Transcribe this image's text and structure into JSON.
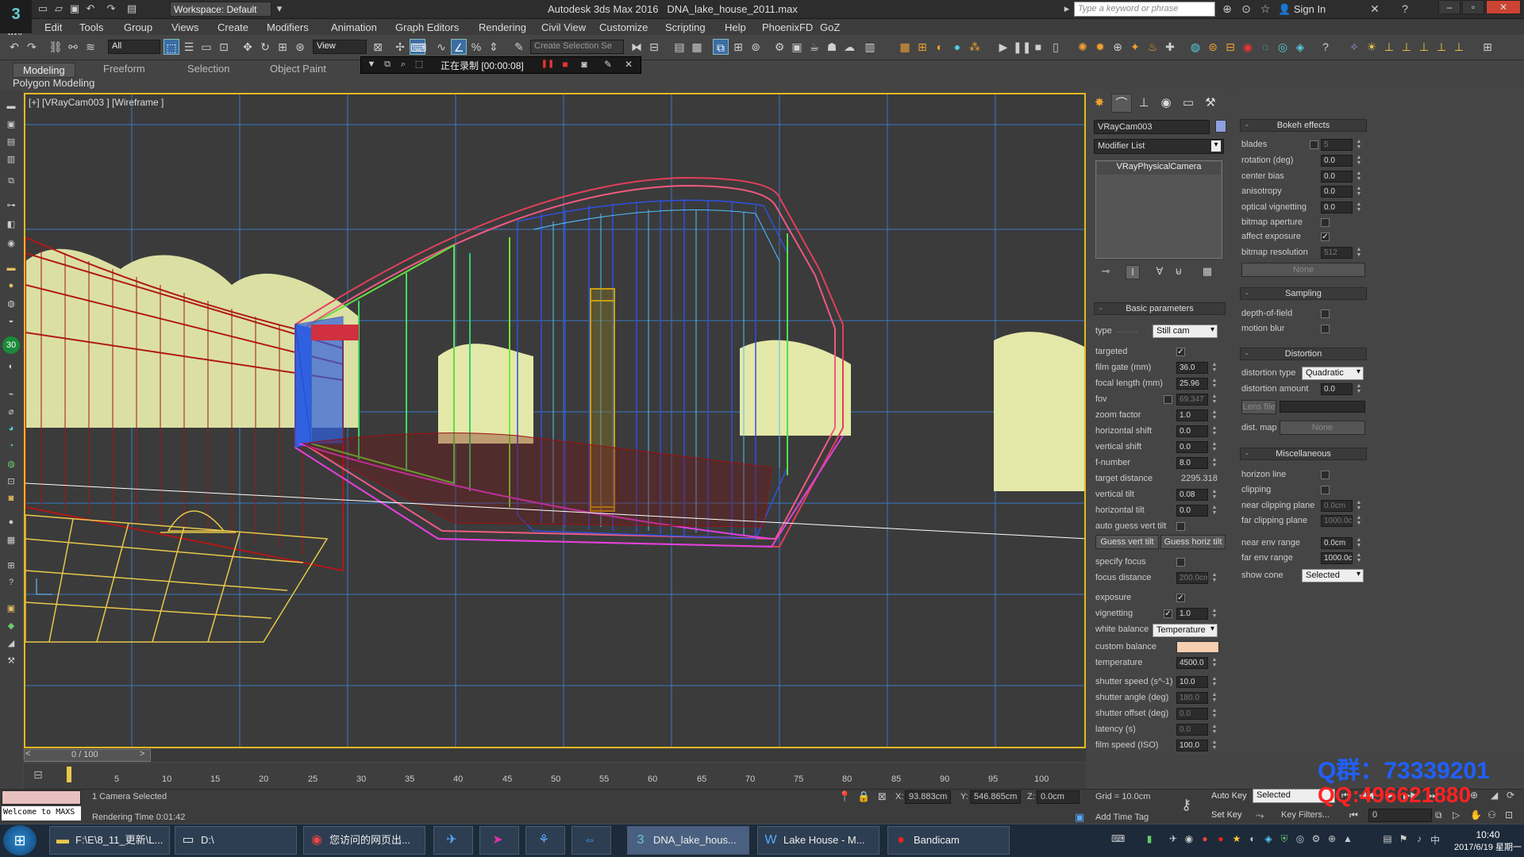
{
  "title": {
    "app": "Autodesk 3ds Max 2016",
    "file": "DNA_lake_house_2011.max",
    "workspace": "Workspace: Default",
    "search_placeholder": "Type a keyword or phrase",
    "signin": "Sign In",
    "logo": "MAX"
  },
  "menu": [
    "Edit",
    "Tools",
    "Group",
    "Views",
    "Create",
    "Modifiers",
    "Animation",
    "Graph Editors",
    "Rendering",
    "Civil View",
    "Customize",
    "Scripting",
    "Help",
    "PhoenixFD",
    "GoZ"
  ],
  "toolbar": {
    "filter": "All",
    "refcoord": "View",
    "selset_placeholder": "Create Selection Se"
  },
  "ribbon": {
    "tabs": [
      "Modeling",
      "Freeform",
      "Selection",
      "Object Paint"
    ],
    "active": "Modeling",
    "subtitle": "Polygon Modeling"
  },
  "recorder": {
    "text": "正在录制 [00:00:08]"
  },
  "viewport": {
    "label": "[+] [VRayCam003 ] [Wireframe ]"
  },
  "panel": {
    "object_name": "VRayCam003",
    "object_color": "#8fa0e0",
    "modifier_list": "Modifier List",
    "stack_item": "VRayPhysicalCamera"
  },
  "basic": {
    "header": "Basic parameters",
    "type_label": "type",
    "type_value": "Still cam",
    "targeted": "targeted",
    "film_gate": {
      "label": "film gate (mm)",
      "value": "36.0"
    },
    "focal_length": {
      "label": "focal length (mm)",
      "value": "25.96"
    },
    "fov": {
      "label": "fov",
      "value": "69.347"
    },
    "zoom_factor": {
      "label": "zoom factor",
      "value": "1.0"
    },
    "hshift": {
      "label": "horizontal shift",
      "value": "0.0"
    },
    "vshift": {
      "label": "vertical shift",
      "value": "0.0"
    },
    "fnumber": {
      "label": "f-number",
      "value": "8.0"
    },
    "target_distance": {
      "label": "target distance",
      "value": "2295.318"
    },
    "vtilt": {
      "label": "vertical tilt",
      "value": "0.08"
    },
    "htilt": {
      "label": "horizontal tilt",
      "value": "0.0"
    },
    "auto_guess": "auto guess vert tilt",
    "guess_vert": "Guess vert tilt",
    "guess_horiz": "Guess horiz tilt",
    "specify_focus": "specify focus",
    "focus_distance": {
      "label": "focus distance",
      "value": "200.0cm"
    },
    "exposure": "exposure",
    "vignetting": {
      "label": "vignetting",
      "value": "1.0"
    },
    "white_balance_label": "white balance",
    "white_balance_value": "Temperature",
    "custom_balance": "custom balance",
    "custom_balance_color": "#f5cfb0",
    "temperature": {
      "label": "temperature",
      "value": "4500.0"
    },
    "shutter_speed": {
      "label": "shutter speed (s^-1)",
      "value": "10.0"
    },
    "shutter_angle": {
      "label": "shutter angle (deg)",
      "value": "180.0"
    },
    "shutter_offset": {
      "label": "shutter offset (deg)",
      "value": "0.0"
    },
    "latency": {
      "label": "latency (s)",
      "value": "0.0"
    },
    "film_speed": {
      "label": "film speed (ISO)",
      "value": "100.0"
    }
  },
  "bokeh": {
    "header": "Bokeh effects",
    "blades": {
      "label": "blades",
      "value": "5"
    },
    "rotation": {
      "label": "rotation (deg)",
      "value": "0.0"
    },
    "center_bias": {
      "label": "center bias",
      "value": "0.0"
    },
    "anisotropy": {
      "label": "anisotropy",
      "value": "0.0"
    },
    "optical_vignetting": {
      "label": "optical vignetting",
      "value": "0.0"
    },
    "bitmap_aperture": "bitmap aperture",
    "affect_exposure": "affect exposure",
    "bitmap_resolution": {
      "label": "bitmap resolution",
      "value": "512"
    },
    "none_btn": "None"
  },
  "sampling": {
    "header": "Sampling",
    "dof": "depth-of-field",
    "motion_blur": "motion blur"
  },
  "distortion": {
    "header": "Distortion",
    "type_label": "distortion type",
    "type_value": "Quadratic",
    "amount": {
      "label": "distortion amount",
      "value": "0.0"
    },
    "lens_file": "Lens file",
    "dist_map": "dist. map",
    "none_btn": "None"
  },
  "misc": {
    "header": "Miscellaneous",
    "horizon": "horizon line",
    "clipping": "clipping",
    "near_clip": {
      "label": "near clipping plane",
      "value": "0.0cm"
    },
    "far_clip": {
      "label": "far clipping plane",
      "value": "1000.0c"
    },
    "near_env": {
      "label": "near env range",
      "value": "0.0cm"
    },
    "far_env": {
      "label": "far env range",
      "value": "1000.0c"
    },
    "show_cone_label": "show cone",
    "show_cone_value": "Selected"
  },
  "timeline": {
    "frame": "0 / 100",
    "ticks": [
      "5",
      "10",
      "15",
      "20",
      "25",
      "30",
      "35",
      "40",
      "45",
      "50",
      "55",
      "60",
      "65",
      "70",
      "75",
      "80",
      "85",
      "90",
      "95",
      "100"
    ]
  },
  "status": {
    "welcome": "Welcome to MAXS",
    "selection": "1 Camera Selected",
    "render_time": "Rendering Time  0:01:42",
    "x_label": "X:",
    "x": "93.883cm",
    "y_label": "Y:",
    "y": "546.865cm",
    "z_label": "Z:",
    "z": "0.0cm",
    "grid": "Grid = 10.0cm",
    "add_time_tag": "Add Time Tag",
    "auto_key": "Auto Key",
    "set_key": "Set Key",
    "selected": "Selected",
    "key_filters": "Key Filters...",
    "frame_value": "0"
  },
  "watermark": {
    "line1": "Q群：73339201",
    "line2": "QQ:496621880"
  },
  "taskbar": {
    "items": [
      {
        "label": "F:\\E\\8_11_更新\\L...",
        "icon": "folder-icon"
      },
      {
        "label": "D:\\",
        "icon": "drive-icon"
      },
      {
        "label": "您访问的网页出...",
        "icon": "browser-icon"
      },
      {
        "label": "",
        "icon": "app-icon"
      },
      {
        "label": "",
        "icon": "arrow-app-icon"
      },
      {
        "label": "",
        "icon": "share-icon"
      },
      {
        "label": "",
        "icon": "teamviewer-icon"
      },
      {
        "label": "DNA_lake_hous...",
        "icon": "max-icon"
      },
      {
        "label": "Lake House - M...",
        "icon": "word-icon"
      },
      {
        "label": "Bandicam",
        "icon": "record-icon"
      }
    ],
    "time": "10:40",
    "date": "2017/6/19 星期一"
  }
}
